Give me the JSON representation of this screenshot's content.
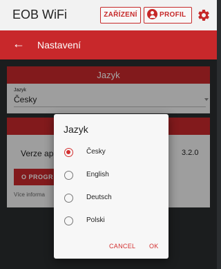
{
  "topbar": {
    "app_title": "EOB WiFi",
    "zarizeni_label": "ZAŘÍZENÍ",
    "profil_label": "PROFIL",
    "settings_icon": "gear-icon",
    "accent_color": "#c62828"
  },
  "appbar": {
    "back_icon": "arrow-left-icon",
    "back_glyph": "←",
    "title": "Nastavení"
  },
  "language_card": {
    "header": "Jazyk",
    "field_label": "Jazyk",
    "field_value": "Česky"
  },
  "info_card": {
    "version_label": "Verze ap",
    "version_value": "3.2.0",
    "program_button": "O PROGR",
    "more_text": "Více informa"
  },
  "dialog": {
    "title": "Jazyk",
    "options": [
      {
        "label": "Česky",
        "selected": true
      },
      {
        "label": "English",
        "selected": false
      },
      {
        "label": "Deutsch",
        "selected": false
      },
      {
        "label": "Polski",
        "selected": false
      }
    ],
    "cancel_label": "CANCEL",
    "ok_label": "OK"
  }
}
